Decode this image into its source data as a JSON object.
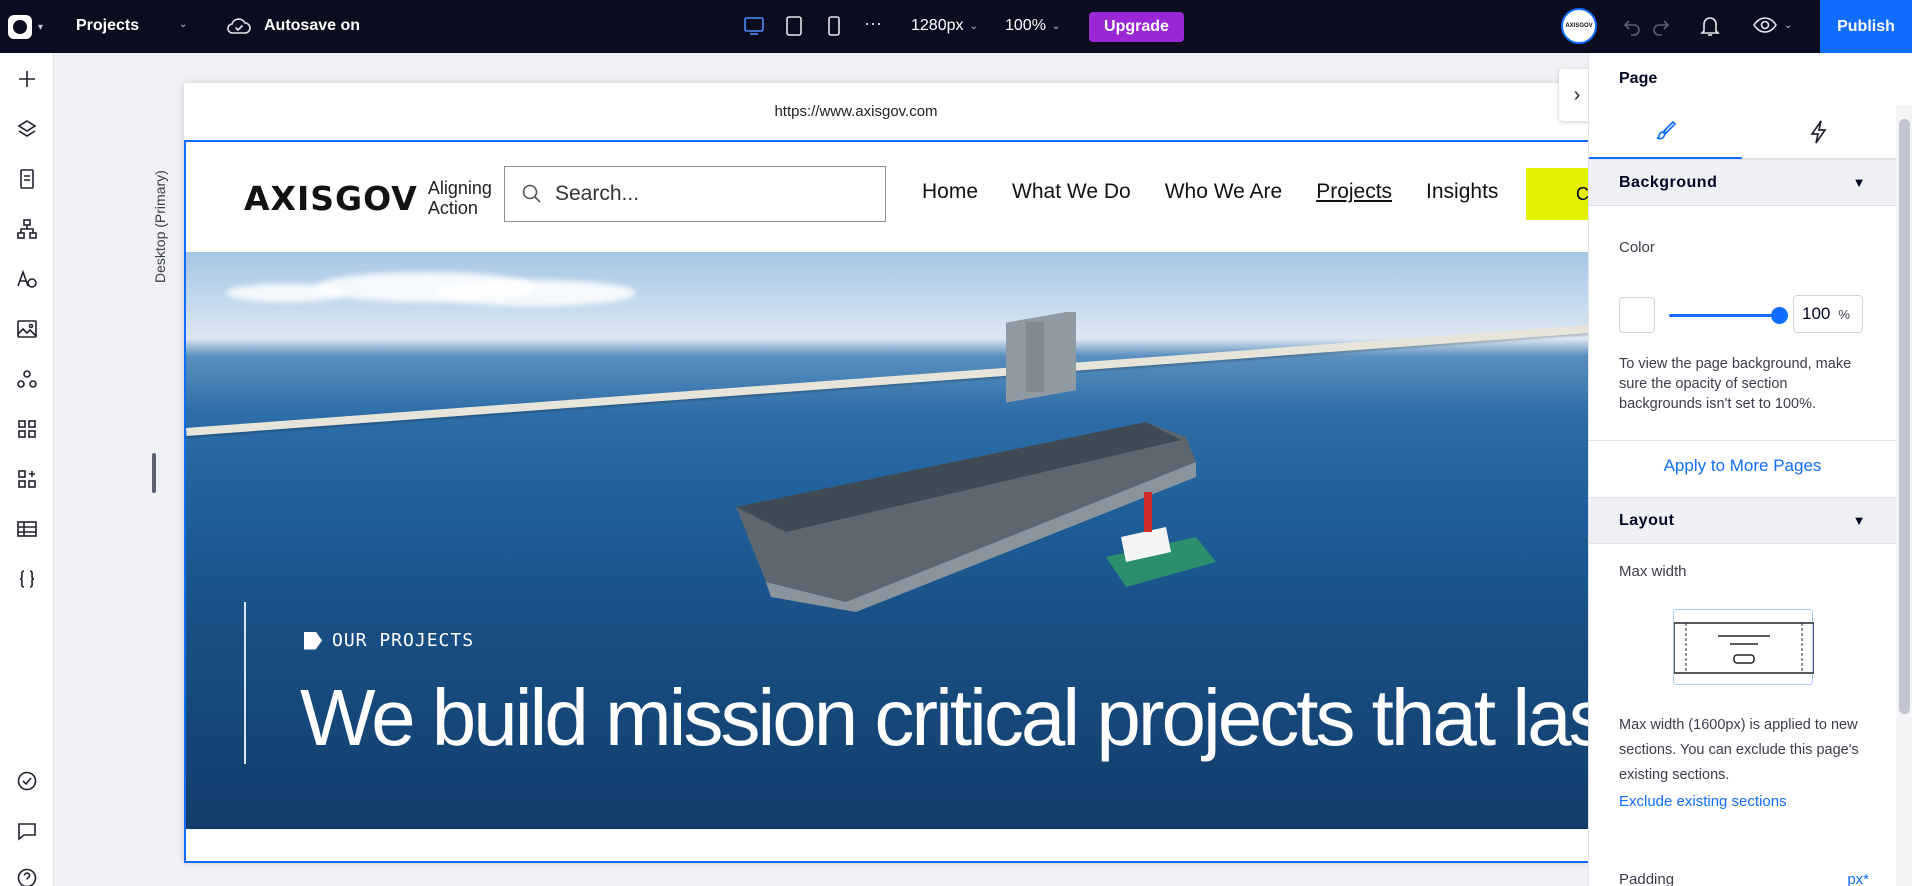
{
  "topbar": {
    "site_menu": "Projects",
    "autosave": "Autosave on",
    "width_value": "1280px",
    "zoom_value": "100%",
    "upgrade_label": "Upgrade",
    "publish_label": "Publish",
    "avatar_text": "AXISGOV",
    "more": "···"
  },
  "canvas": {
    "breakpoint_label": "Desktop (Primary)",
    "url": "https://www.axisgov.com"
  },
  "site": {
    "brand_name": "AXISGOV",
    "brand_tagline_1": "Aligning",
    "brand_tagline_2": "Action",
    "search_placeholder": "Search...",
    "nav": [
      "Home",
      "What We Do",
      "Who We Are",
      "Projects",
      "Insights"
    ],
    "cta_label": "C",
    "hero_eyebrow": "OUR PROJECTS",
    "hero_title": "We build mission critical projects that last"
  },
  "inspector": {
    "title": "Page",
    "background_section": "Background",
    "color_label": "Color",
    "opacity_value": "100",
    "opacity_unit": "%",
    "opacity_level": 1.0,
    "background_note": "To view the page background, make sure the opacity of section backgrounds isn't set to 100%.",
    "apply_link": "Apply to More Pages",
    "layout_section": "Layout",
    "max_width_label": "Max width",
    "max_width_note": "Max width (1600px) is applied to new sections. You can exclude this page's existing sections.",
    "exclude_link": "Exclude existing sections",
    "padding_label": "Padding",
    "padding_unit": "px*"
  },
  "colors": {
    "topbar_bg": "#0b0c1f",
    "accent_blue": "#116dff",
    "upgrade_purple": "#9a27d5",
    "cta_yellow": "#e3f000"
  }
}
